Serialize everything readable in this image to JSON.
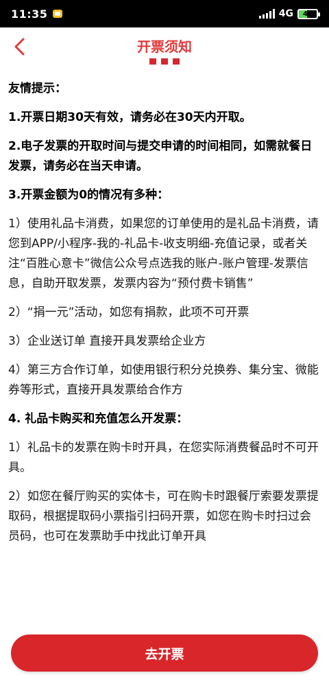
{
  "status_bar": {
    "time": "11:35",
    "network": "4G",
    "battery": "46",
    "battery_level": 0.46
  },
  "header": {
    "title": "开票须知"
  },
  "content": {
    "paragraphs": [
      {
        "text": "友情提示：",
        "bold": true
      },
      {
        "text": "1.开票日期30天有效，请务必在30天内开取。",
        "bold": true
      },
      {
        "text": "2.电子发票的开取时间与提交申请的时间相同，如需就餐日发票，请务必在当天申请。",
        "bold": true
      },
      {
        "text": "3.开票金额为0的情况有多种：",
        "bold": true
      },
      {
        "text": "1）使用礼品卡消费，如果您的订单使用的是礼品卡消费，请您到APP/小程序-我的-礼品卡-收支明细-充值记录，或者关注“百胜心意卡”微信公众号点选我的账户-账户管理-发票信息，自助开取发票，发票内容为“预付费卡销售”",
        "bold": false
      },
      {
        "text": "2）“捐一元”活动，如您有捐款，此项不可开票",
        "bold": false
      },
      {
        "text": "3）企业送订单  直接开具发票给企业方",
        "bold": false
      },
      {
        "text": "4）第三方合作订单，如使用银行积分兑换券、集分宝、微能券等形式，直接开具发票给合作方",
        "bold": false
      },
      {
        "text": "4. 礼品卡购买和充值怎么开发票：",
        "bold": true
      },
      {
        "text": "1）礼品卡的发票在购卡时开具，在您实际消费餐品时不可开具。",
        "bold": false
      },
      {
        "text": "2）如您在餐厅购买的实体卡，可在购卡时跟餐厅索要发票提取码，根据提取码小票指引扫码开票，如您在购卡时扫过会员码，也可在发票助手中找此订单开具",
        "bold": false
      }
    ]
  },
  "bottom": {
    "button_label": "去开票"
  },
  "colors": {
    "accent": "#d9262b",
    "title": "#e23a3a"
  }
}
